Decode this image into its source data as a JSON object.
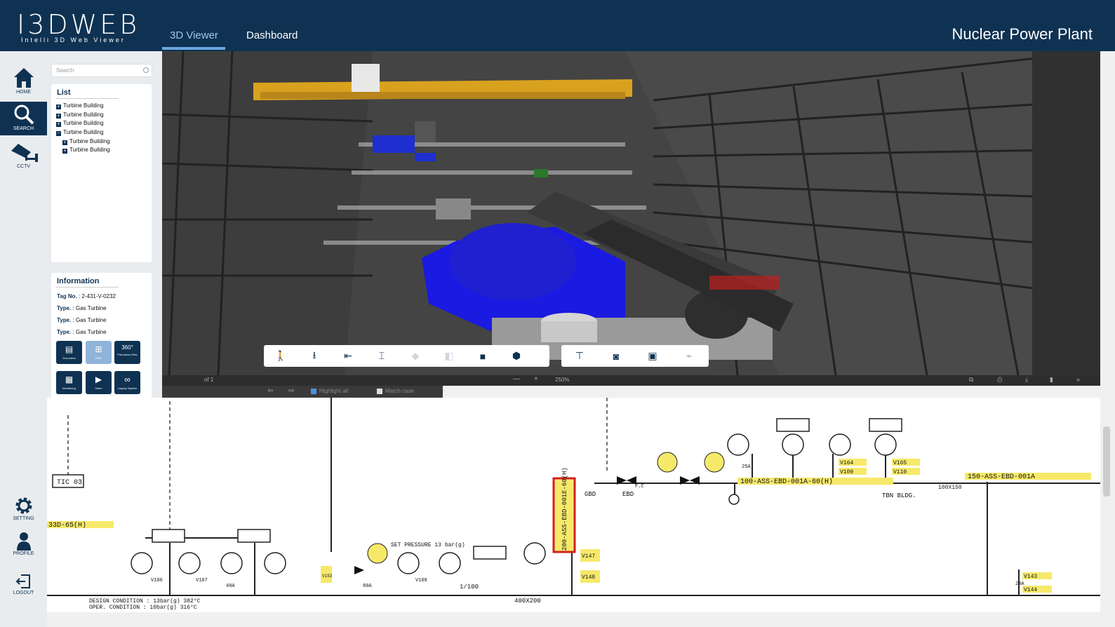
{
  "header": {
    "logo_main": "I3DWEB",
    "logo_sub": "Intelli 3D Web Viewer",
    "tabs": [
      {
        "label": "3D Viewer",
        "active": true
      },
      {
        "label": "Dashboard",
        "active": false
      }
    ],
    "title": "Nuclear Power Plant"
  },
  "sidebar": {
    "items": [
      {
        "label": "HOME",
        "icon": "home-icon"
      },
      {
        "label": "SEARCH",
        "icon": "search-icon",
        "active": true
      },
      {
        "label": "CCTV",
        "icon": "cctv-icon"
      },
      {
        "label": "SETTING",
        "icon": "gear-icon"
      },
      {
        "label": "PROFILE",
        "icon": "user-icon"
      },
      {
        "label": "LOGOUT",
        "icon": "logout-icon"
      }
    ]
  },
  "search": {
    "placeholder": "Search"
  },
  "list": {
    "title": "List",
    "items": [
      {
        "label": "Turbine Building",
        "expanded": false,
        "level": 0
      },
      {
        "label": "Turbine Building",
        "expanded": false,
        "level": 0
      },
      {
        "label": "Turbine Building",
        "expanded": false,
        "level": 0
      },
      {
        "label": "Turbine Building",
        "expanded": true,
        "level": 0
      },
      {
        "label": "Turbine Building",
        "expanded": false,
        "level": 1
      },
      {
        "label": "Turbine Building",
        "expanded": false,
        "level": 1
      }
    ]
  },
  "information": {
    "title": "Information",
    "rows": [
      {
        "key": "Tag No.",
        "value": "2-431-V-0232"
      },
      {
        "key": "Type.",
        "value": "Gas Turbine"
      },
      {
        "key": "Type.",
        "value": "Gas Turbine"
      },
      {
        "key": "Type.",
        "value": "Gas Turbine"
      }
    ],
    "tiles": [
      {
        "label": "Document",
        "icon": "document-icon"
      },
      {
        "label": "P&ID",
        "icon": "pid-icon",
        "dim": true
      },
      {
        "label": "Panorama View",
        "icon": "panorama-360-icon",
        "badge": "360°"
      },
      {
        "label": "Monitoring",
        "icon": "monitoring-icon"
      },
      {
        "label": "Video",
        "icon": "video-icon"
      },
      {
        "label": "Legacy System",
        "icon": "legacy-system-icon"
      }
    ]
  },
  "viewer_toolbar": {
    "left": [
      "walk-icon",
      "person-height-icon",
      "fly-through-icon",
      "measure-icon",
      "view-top-icon",
      "view-side-icon",
      "view-front-icon",
      "view-iso-icon"
    ],
    "right": [
      "hierarchy-icon",
      "camera-info-icon",
      "properties-icon",
      "cctv-camera-icon"
    ]
  },
  "pdf_viewer": {
    "page_of": "of 1",
    "zoom": "250%",
    "highlight_all": "Highlight all",
    "match_case": "Match case"
  },
  "pid_labels": {
    "line_main": "100-ASS-EBD-001A-60(H)",
    "line_right": "150-ASS-EBD-001A",
    "line_vertical": "200-ASS-EBD-001E-60(H)",
    "line_left": "33D-65(H)",
    "tic": "TIC 03",
    "design": "DESIGN CONDITION : 13bar(g) 382°C",
    "oper": "OPER. CONDITION : 10bar(g) 316°C",
    "set_pressure": "SET PRESSURE 13 bar(g)",
    "tbn": "TBN BLDG.",
    "gbd": "GBD",
    "ebd": "EBD",
    "reducer": "400X200",
    "slope": "1/100",
    "v164": "V164",
    "v165": "V165",
    "v109": "V109",
    "v110": "V110",
    "v143": "V143",
    "v144": "V144",
    "v147": "V147",
    "v148": "V148",
    "v153": "V153",
    "v106": "V106",
    "v107": "V107",
    "v108": "V108",
    "size_20a": "20A",
    "size_25a": "25A",
    "size_40a": "40A",
    "size_80a": "80A",
    "size_100x150": "100X150",
    "fc": "F.C"
  }
}
